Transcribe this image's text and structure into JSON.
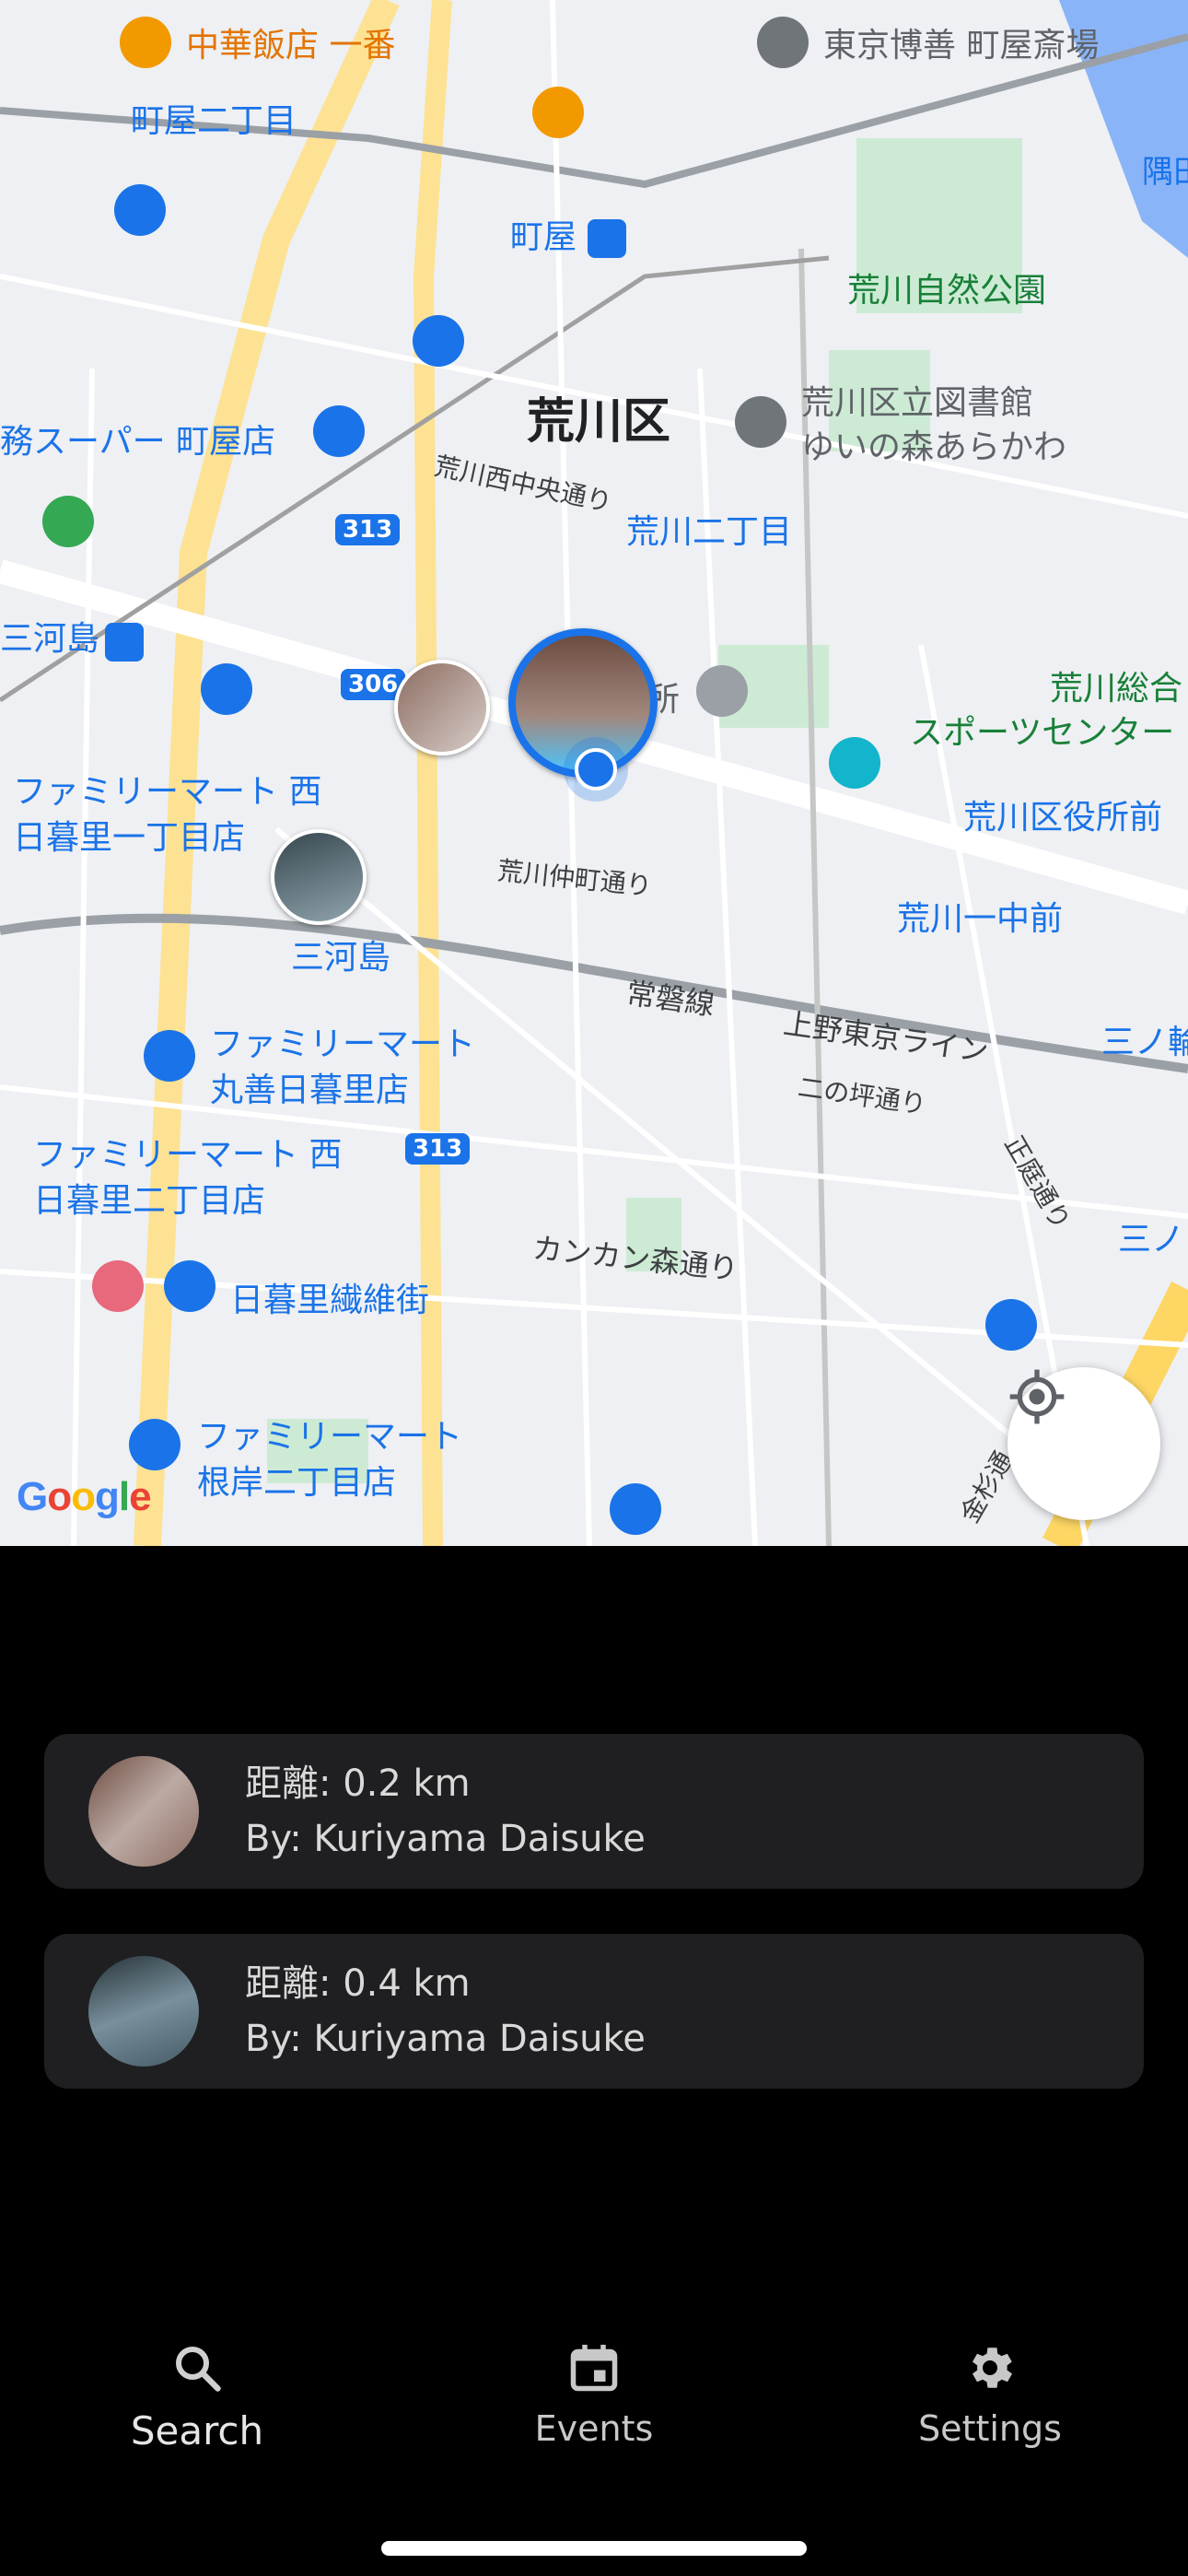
{
  "map": {
    "labels": {
      "chuka": "中華飯店 一番",
      "tokyo_hakuzen": "東京博善 町屋斎場",
      "machiya_2": "町屋二丁目",
      "sumida": "隅田",
      "machiya": "町屋",
      "arakawa_park": "荒川自然公園",
      "arakawa_ku": "荒川区",
      "library_1": "荒川区立図書館",
      "library_2": "ゆいの森あらかわ",
      "gyomu": "務スーパー 町屋店",
      "nishi_chuo": "荒川西中央通り",
      "arakawa_2": "荒川二丁目",
      "mikawashima_top": "三河島",
      "sports_1": "荒川総合",
      "sports_2": "スポーツセンター",
      "fm_nishi_1": "ファミリーマート 西",
      "fm_nishi_2": "日暮里一丁目店",
      "ward_office": "荒川区役所前",
      "nakamachi": "荒川仲町通り",
      "arakawa_ichichu": "荒川一中前",
      "mikawashima": "三河島",
      "joban": "常磐線",
      "ueno_tokyo": "上野東京ライン",
      "sannowa": "三ノ輪",
      "ninotsubo": "二の坪通り",
      "fm_maruzen_1": "ファミリーマート",
      "fm_maruzen_2": "丸善日暮里店",
      "fm_nishi2_1": "ファミリーマート 西",
      "fm_nishi2_2": "日暮里二丁目店",
      "shoden": "正庭通り",
      "kankan": "カンカン森通り",
      "sanno2": "三ノ",
      "seni": "日暮里繊維街",
      "fm_negishi_1": "ファミリーマート",
      "fm_negishi_2": "根岸二丁目店",
      "kanasugi": "金杉通",
      "shrine_suffix": "所",
      "route_313a": "313",
      "route_306": "306",
      "route_313b": "313"
    },
    "google_logo": "Google",
    "icons": {
      "locate": "my-location-icon",
      "restaurant": "restaurant-icon",
      "place": "place-icon",
      "shopping": "shopping-cart-icon",
      "store": "convenience-store-icon",
      "station": "train-station-icon",
      "hotel": "hotel-icon",
      "library": "library-icon"
    }
  },
  "results": [
    {
      "distance": "距離: 0.2 km",
      "author": "By: Kuriyama Daisuke"
    },
    {
      "distance": "距離: 0.4 km",
      "author": "By: Kuriyama Daisuke"
    }
  ],
  "nav": {
    "search": {
      "label": "Search",
      "icon": "search-icon"
    },
    "events": {
      "label": "Events",
      "icon": "calendar-icon"
    },
    "settings": {
      "label": "Settings",
      "icon": "gear-icon"
    }
  },
  "colors": {
    "accent_blue": "#1a73e8",
    "card_bg": "#1f1f22",
    "app_bg": "#000000"
  }
}
